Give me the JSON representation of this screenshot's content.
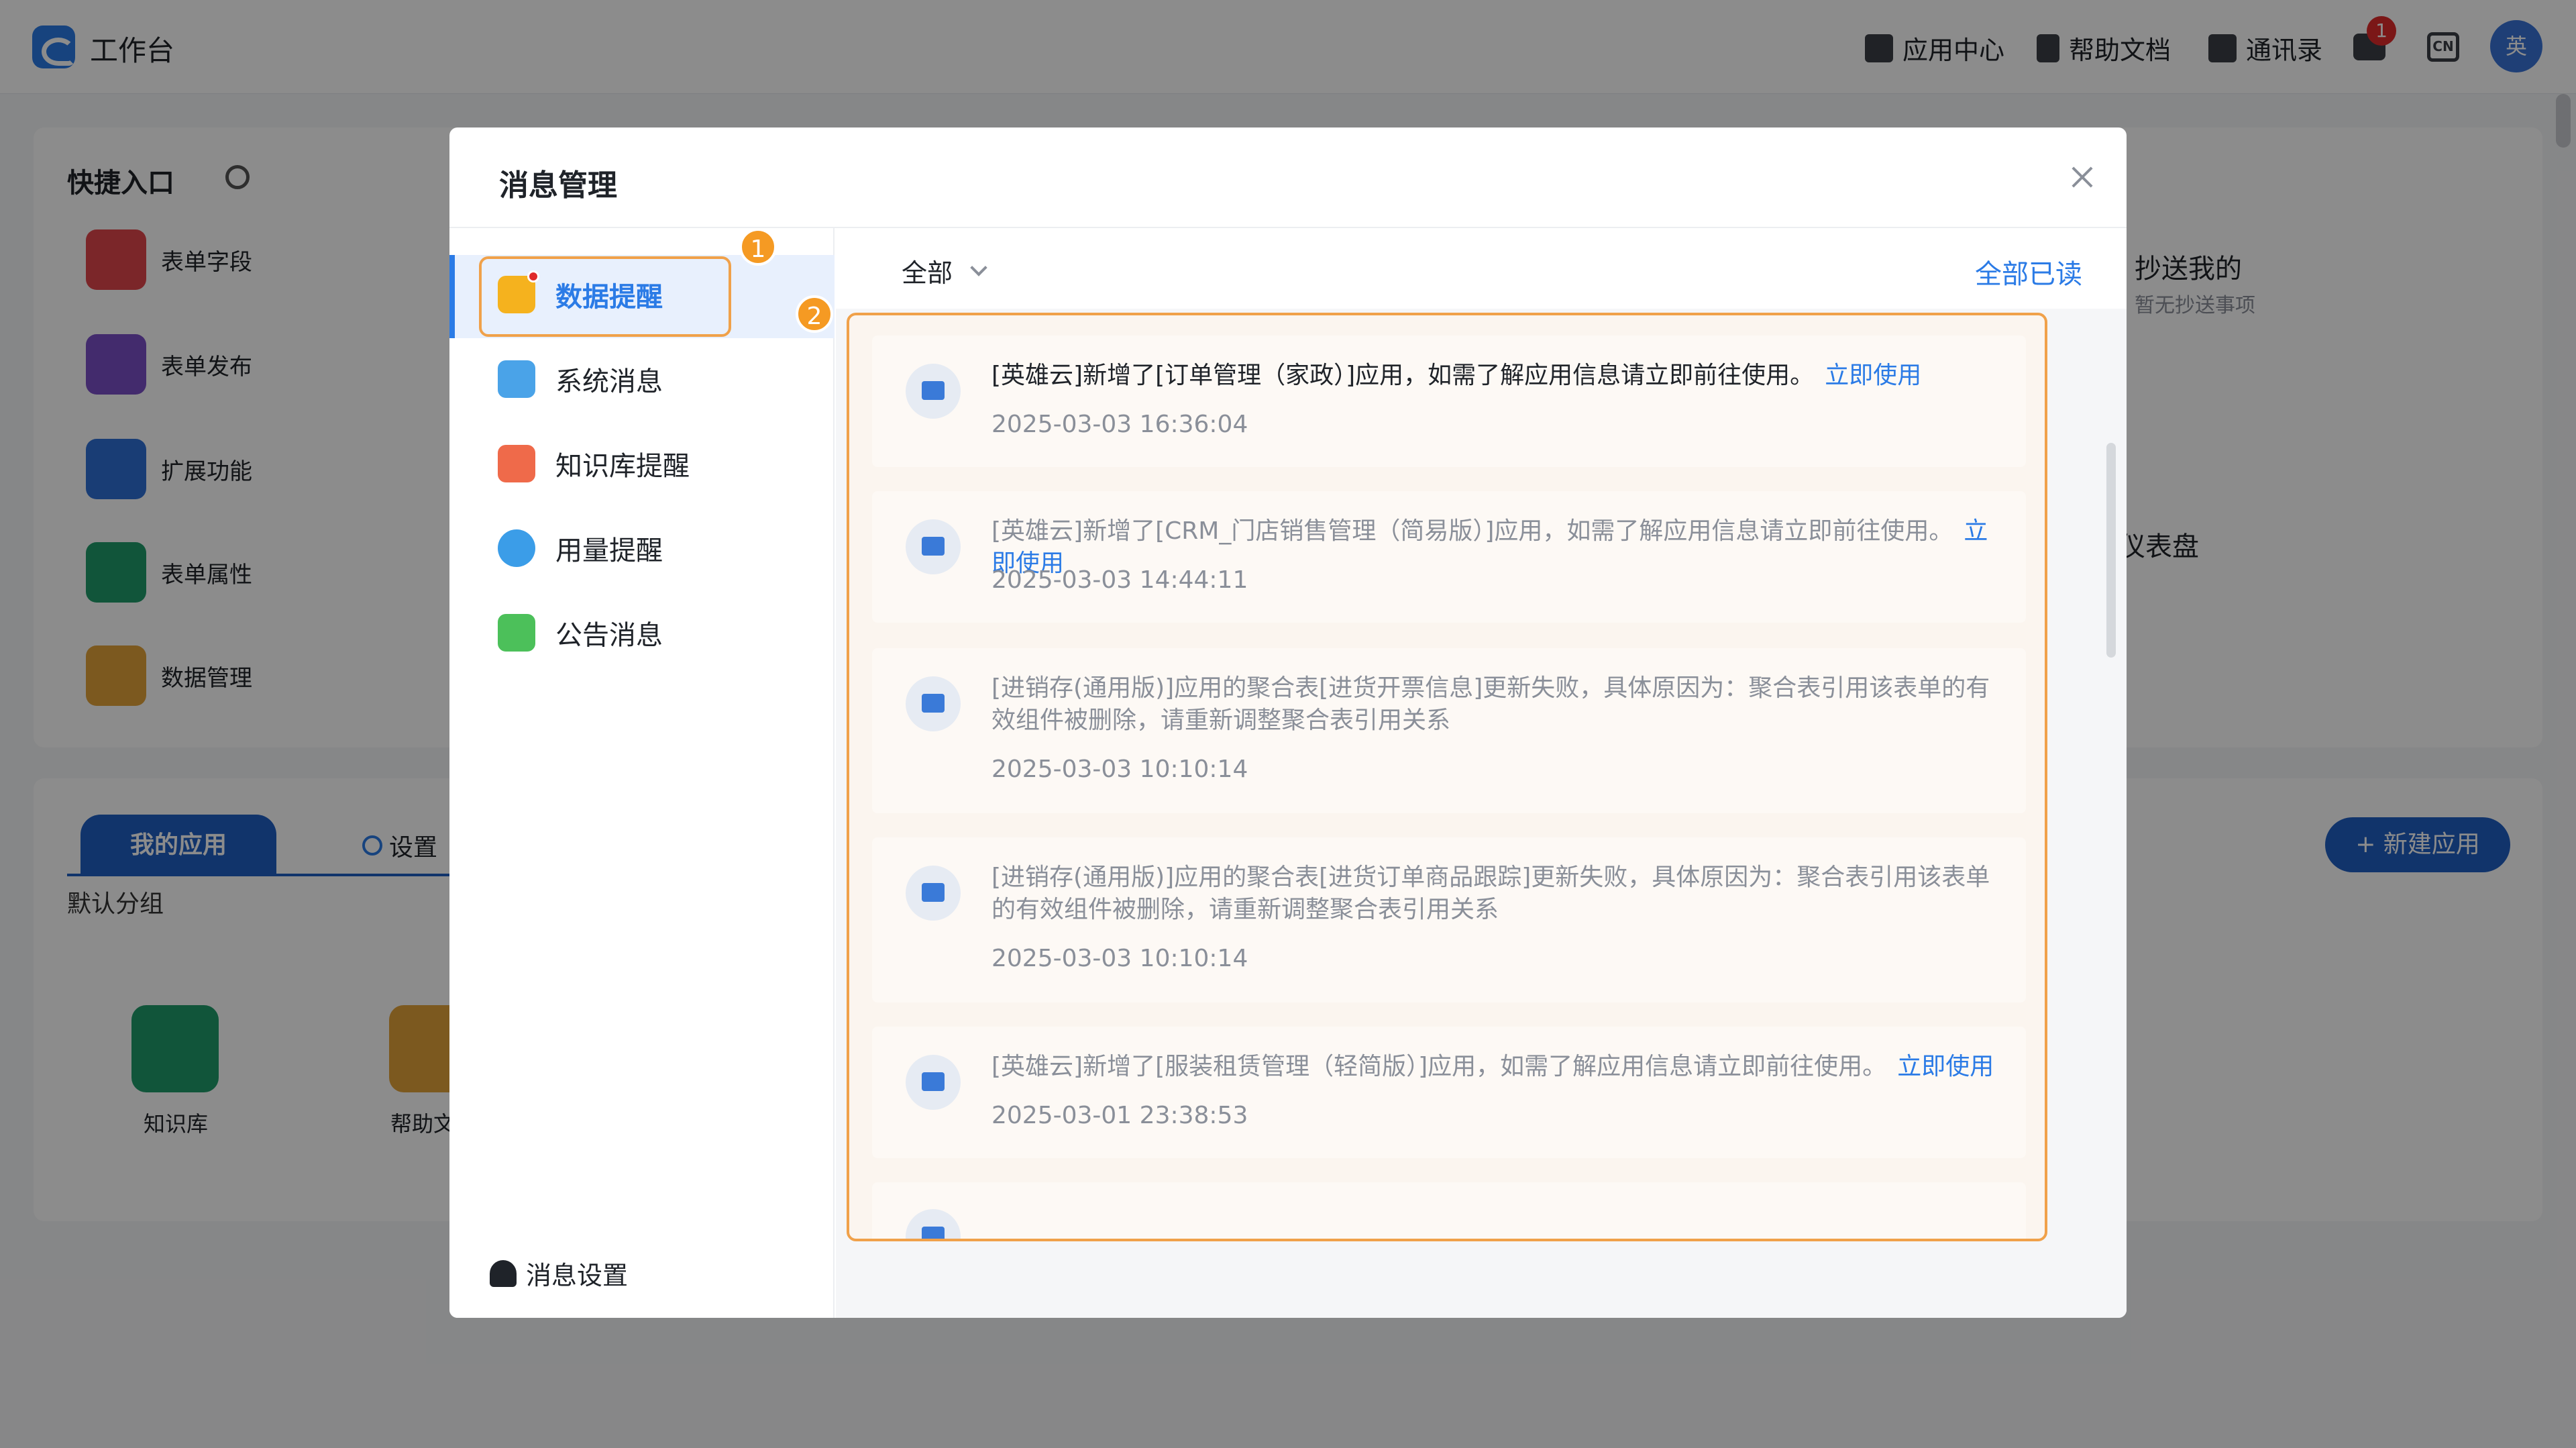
{
  "topbar": {
    "app_title": "工作台",
    "items": [
      "应用中心",
      "帮助文档",
      "通讯录"
    ],
    "badge_count": "1",
    "lang_label": "CN",
    "avatar_text": "英"
  },
  "quick": {
    "title": "快捷入口",
    "items": [
      "表单字段",
      "表单发布",
      "扩展功能",
      "表单属性",
      "数据管理"
    ]
  },
  "apps": {
    "tab_active": "我的应用",
    "tab_settings": "设置",
    "group_label": "默认分组",
    "new_app": "新建应用",
    "items": [
      "知识库",
      "帮助文"
    ]
  },
  "right_panel": {
    "cc_title": "抄送我的",
    "cc_sub": "暂无抄送事项",
    "dashboard_text": "仪表盘"
  },
  "modal": {
    "title": "消息管理",
    "sidebar": [
      "数据提醒",
      "系统消息",
      "知识库提醒",
      "用量提醒",
      "公告消息"
    ],
    "footer": "消息设置",
    "filter": "全部",
    "read_all": "全部已读",
    "steps": [
      "1",
      "2"
    ],
    "messages": [
      {
        "text": "[英雄云]新增了[订单管理（家政）]应用，如需了解应用信息请立即前往使用。",
        "link": "立即使用",
        "time": "2025-03-03 16:36:04"
      },
      {
        "text": "[英雄云]新增了[CRM_门店销售管理（简易版）]应用，如需了解应用信息请立即前往使用。",
        "link": "立即使用",
        "time": "2025-03-03 14:44:11"
      },
      {
        "text": "[进销存(通用版)]应用的聚合表[进货开票信息]更新失败，具体原因为：聚合表引用该表单的有效组件被删除，请重新调整聚合表引用关系",
        "link": "",
        "time": "2025-03-03 10:10:14"
      },
      {
        "text": "[进销存(通用版)]应用的聚合表[进货订单商品跟踪]更新失败，具体原因为：聚合表引用该表单的有效组件被删除，请重新调整聚合表引用关系",
        "link": "",
        "time": "2025-03-03 10:10:14"
      },
      {
        "text": "[英雄云]新增了[服装租赁管理（轻简版）]应用，如需了解应用信息请立即前往使用。",
        "link": "立即使用",
        "time": "2025-03-01 23:38:53"
      }
    ]
  },
  "colors": {
    "accent": "#2b7be6",
    "highlight": "#f0a14a",
    "step_badge": "#f59a23"
  }
}
